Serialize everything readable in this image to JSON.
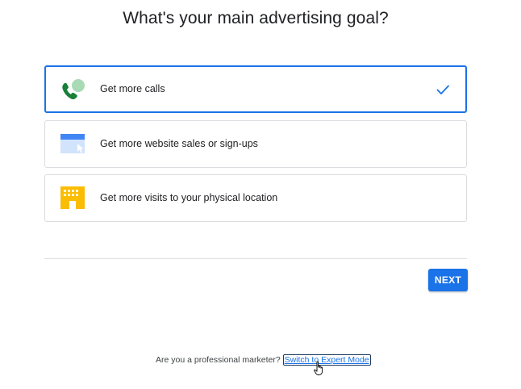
{
  "page": {
    "heading": "What's your main advertising goal?"
  },
  "goals": [
    {
      "label": "Get more calls",
      "icon": "phone-icon",
      "selected": true,
      "selected_icon": "checkmark-icon"
    },
    {
      "label": "Get more website sales or sign-ups",
      "icon": "browser-window-icon",
      "selected": false
    },
    {
      "label": "Get more visits to your physical location",
      "icon": "storefront-icon",
      "selected": false
    }
  ],
  "actions": {
    "next_label": "NEXT"
  },
  "footer": {
    "prompt": "Are you a professional marketer?",
    "link_label": "Switch to Expert Mode"
  },
  "colors": {
    "accent": "#1a73e8",
    "phone_green": "#188038",
    "yellow": "#fbbc04"
  }
}
